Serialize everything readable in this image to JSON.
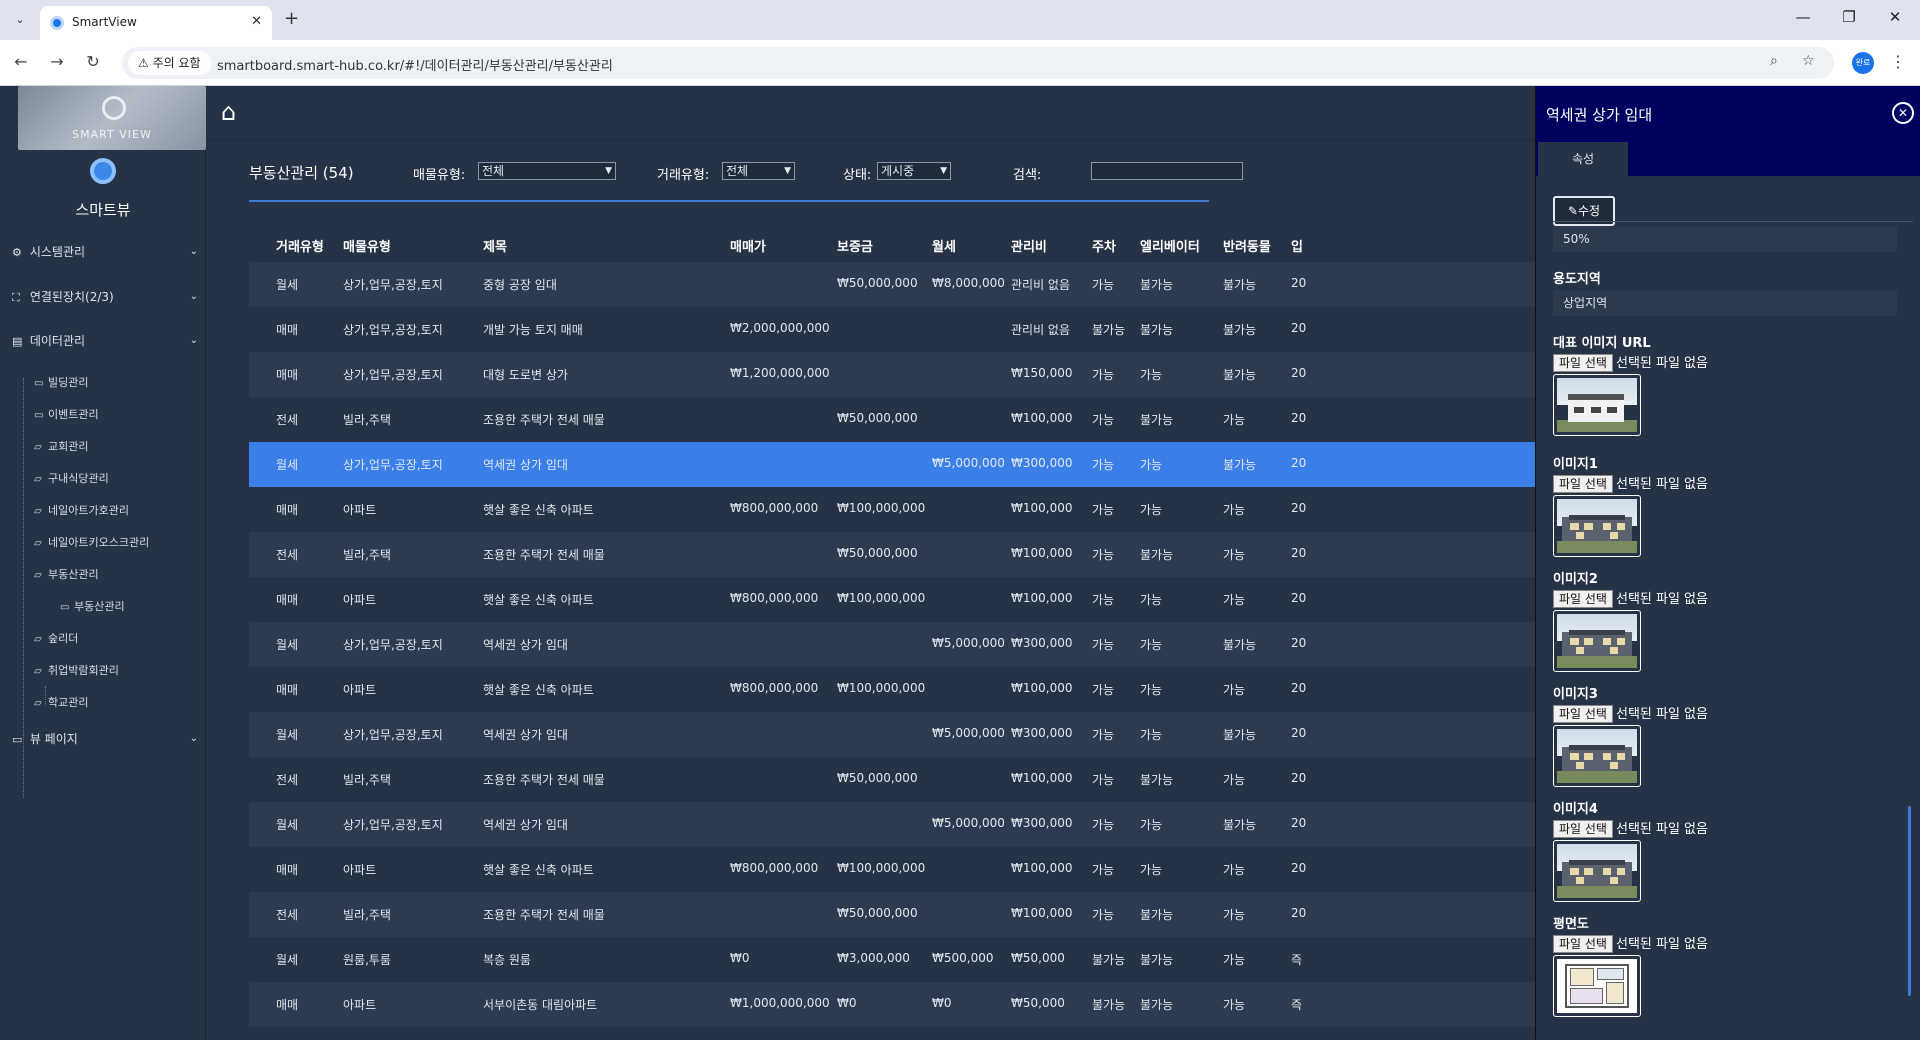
{
  "browser": {
    "tab_title": "SmartView",
    "tab_close": "✕",
    "new_tab": "+",
    "security_label": "⚠ 주의 요함",
    "url": "smartboard.smart-hub.co.kr/#!/데이터관리/부동산관리/부동산관리",
    "profile_label": "완료"
  },
  "sidebar": {
    "logo_text": "SMART VIEW",
    "brand_name": "스마트뷰",
    "menus": [
      {
        "label": "시스템관리",
        "icon": "⚙"
      },
      {
        "label": "연결된장치(2/3)",
        "icon": "⛶"
      },
      {
        "label": "데이터관리",
        "icon": "▤"
      },
      {
        "label": "뷰 페이지",
        "icon": "▭"
      }
    ],
    "sub_items": [
      {
        "label": "빌딩관리",
        "icon": "▭"
      },
      {
        "label": "이벤트관리",
        "icon": "▭"
      },
      {
        "label": "교회관리",
        "icon": "▱"
      },
      {
        "label": "구내식당관리",
        "icon": "▱"
      },
      {
        "label": "네일아트가호관리",
        "icon": "▱"
      },
      {
        "label": "네일아트키오스크관리",
        "icon": "▱"
      },
      {
        "label": "부동산관리",
        "icon": "▱"
      },
      {
        "label": "부동산관리",
        "icon": "▭"
      },
      {
        "label": "숲리더",
        "icon": "▱"
      },
      {
        "label": "취업박람회관리",
        "icon": "▱"
      },
      {
        "label": "학교관리",
        "icon": "▱"
      }
    ]
  },
  "main": {
    "page_title": "부동산관리 (54)",
    "filters": {
      "property_type_label": "매물유형:",
      "property_type_value": "전체",
      "deal_type_label": "거래유형:",
      "deal_type_value": "전체",
      "status_label": "상태:",
      "status_value": "게시중",
      "search_label": "검색:",
      "search_value": ""
    },
    "columns": [
      "거래유형",
      "매물유형",
      "제목",
      "매매가",
      "보증금",
      "월세",
      "관리비",
      "주차",
      "엘리베이터",
      "반려동물",
      "입"
    ],
    "rows": [
      [
        "월세",
        "상가,업무,공장,토지",
        "중형 공장 임대",
        "",
        "₩50,000,000",
        "₩8,000,000",
        "관리비 없음",
        "가능",
        "불가능",
        "불가능",
        "20"
      ],
      [
        "매매",
        "상가,업무,공장,토지",
        "개발 가능 토지 매매",
        "₩2,000,000,000",
        "",
        "",
        "관리비 없음",
        "불가능",
        "불가능",
        "불가능",
        "20"
      ],
      [
        "매매",
        "상가,업무,공장,토지",
        "대형 도로변 상가",
        "₩1,200,000,000",
        "",
        "",
        "₩150,000",
        "가능",
        "가능",
        "불가능",
        "20"
      ],
      [
        "전세",
        "빌라,주택",
        "조용한 주택가 전세 매물",
        "",
        "₩50,000,000",
        "",
        "₩100,000",
        "가능",
        "불가능",
        "가능",
        "20"
      ],
      [
        "월세",
        "상가,업무,공장,토지",
        "역세권 상가 임대",
        "",
        "",
        "₩5,000,000",
        "₩300,000",
        "가능",
        "가능",
        "불가능",
        "20"
      ],
      [
        "매매",
        "아파트",
        "햇살 좋은 신축 아파트",
        "₩800,000,000",
        "₩100,000,000",
        "",
        "₩100,000",
        "가능",
        "가능",
        "가능",
        "20"
      ],
      [
        "전세",
        "빌라,주택",
        "조용한 주택가 전세 매물",
        "",
        "₩50,000,000",
        "",
        "₩100,000",
        "가능",
        "불가능",
        "가능",
        "20"
      ],
      [
        "매매",
        "아파트",
        "햇살 좋은 신축 아파트",
        "₩800,000,000",
        "₩100,000,000",
        "",
        "₩100,000",
        "가능",
        "가능",
        "가능",
        "20"
      ],
      [
        "월세",
        "상가,업무,공장,토지",
        "역세권 상가 임대",
        "",
        "",
        "₩5,000,000",
        "₩300,000",
        "가능",
        "가능",
        "불가능",
        "20"
      ],
      [
        "매매",
        "아파트",
        "햇살 좋은 신축 아파트",
        "₩800,000,000",
        "₩100,000,000",
        "",
        "₩100,000",
        "가능",
        "가능",
        "가능",
        "20"
      ],
      [
        "월세",
        "상가,업무,공장,토지",
        "역세권 상가 임대",
        "",
        "",
        "₩5,000,000",
        "₩300,000",
        "가능",
        "가능",
        "불가능",
        "20"
      ],
      [
        "전세",
        "빌라,주택",
        "조용한 주택가 전세 매물",
        "",
        "₩50,000,000",
        "",
        "₩100,000",
        "가능",
        "불가능",
        "가능",
        "20"
      ],
      [
        "월세",
        "상가,업무,공장,토지",
        "역세권 상가 임대",
        "",
        "",
        "₩5,000,000",
        "₩300,000",
        "가능",
        "가능",
        "불가능",
        "20"
      ],
      [
        "매매",
        "아파트",
        "햇살 좋은 신축 아파트",
        "₩800,000,000",
        "₩100,000,000",
        "",
        "₩100,000",
        "가능",
        "가능",
        "가능",
        "20"
      ],
      [
        "전세",
        "빌라,주택",
        "조용한 주택가 전세 매물",
        "",
        "₩50,000,000",
        "",
        "₩100,000",
        "가능",
        "불가능",
        "가능",
        "20"
      ],
      [
        "월세",
        "원룸,투룸",
        "복층 원룸",
        "₩0",
        "₩3,000,000",
        "₩500,000",
        "₩50,000",
        "불가능",
        "불가능",
        "가능",
        "즉"
      ],
      [
        "매매",
        "아파트",
        "서부이촌동 대림아파트",
        "₩1,000,000,000",
        "₩0",
        "₩0",
        "₩50,000",
        "불가능",
        "불가능",
        "가능",
        "즉"
      ]
    ],
    "selected_row": 4
  },
  "panel": {
    "title": "역세권 상가 임대",
    "tab_label": "속성",
    "edit_label": "수정",
    "top_value": "50%",
    "zone_label": "용도지역",
    "zone_value": "상업지역",
    "file_button": "파일 선택",
    "file_none": "선택된 파일 없음",
    "image_sections": [
      {
        "label": "대표 이미지 URL",
        "kind": "house-a"
      },
      {
        "label": "이미지1",
        "kind": "house-b"
      },
      {
        "label": "이미지2",
        "kind": "house-b"
      },
      {
        "label": "이미지3",
        "kind": "house-b"
      },
      {
        "label": "이미지4",
        "kind": "house-b"
      },
      {
        "label": "평면도",
        "kind": "plan"
      }
    ]
  },
  "colors": {
    "selected_row": "#3a7ee8",
    "panel_header": "#00005e",
    "accent": "#3d7bd8"
  }
}
